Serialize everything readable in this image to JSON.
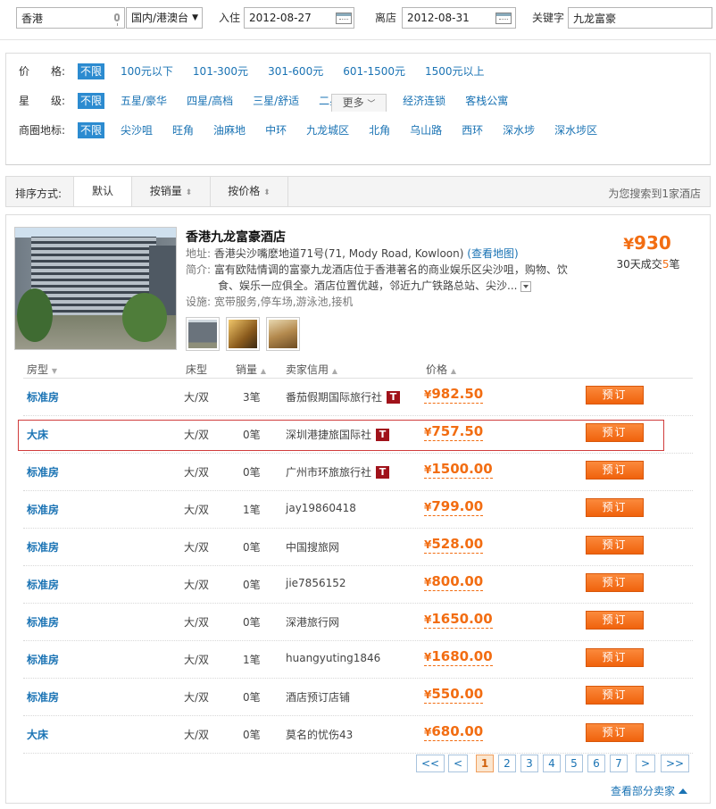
{
  "search": {
    "city": "香港",
    "region": "国内/港澳台",
    "checkin_label": "入住",
    "checkin": "2012-08-27",
    "checkout_label": "离店",
    "checkout": "2012-08-31",
    "keyword_label": "关键字",
    "keyword": "九龙富豪"
  },
  "filters": [
    {
      "label": "价　　格:",
      "options": [
        "不限",
        "100元以下",
        "101-300元",
        "301-600元",
        "601-1500元",
        "1500元以上"
      ]
    },
    {
      "label": "星　　级:",
      "options": [
        "不限",
        "五星/豪华",
        "四星/高档",
        "三星/舒适",
        "二星级及以下",
        "经济连锁",
        "客栈公寓"
      ]
    },
    {
      "label": "商圈地标:",
      "options": [
        "不限",
        "尖沙咀",
        "旺角",
        "油麻地",
        "中环",
        "九龙城区",
        "北角",
        "乌山路",
        "西环",
        "深水埗",
        "深水埗区"
      ]
    }
  ],
  "more_label": "更多",
  "sort": {
    "label": "排序方式:",
    "items": [
      "默认",
      "按销量",
      "按价格"
    ],
    "found": "为您搜索到1家酒店"
  },
  "hotel": {
    "name": "香港九龙富豪酒店",
    "address_label": "地址:",
    "address": "香港尖沙嘴麽地道71号(71, Mody Road, Kowloon)",
    "map_link": "(查看地图)",
    "intro_label": "简介:",
    "intro_line1": "富有欧陆情调的富豪九龙酒店位于香港著名的商业娱乐区尖沙咀，购物、饮",
    "intro_line2": "食、娱乐一应俱全。酒店位置优越，邻近九广铁路总站、尖沙...",
    "facilities_label": "设施:",
    "facilities": "宽带服务,停车场,游泳池,接机",
    "min_price_symbol": "¥",
    "min_price": "930",
    "deal_prefix": "30天成交",
    "deal_count": "5",
    "deal_suffix": "笔"
  },
  "table": {
    "headers": {
      "room": "房型",
      "bed": "床型",
      "sales": "销量",
      "seller": "卖家信用",
      "price": "价格"
    },
    "book_label": "预订",
    "rows": [
      {
        "room": "标准房",
        "bed": "大/双",
        "sales": "3笔",
        "seller": "番茄假期国际旅行社",
        "badge": "T",
        "price": "982.50"
      },
      {
        "room": "大床",
        "bed": "大/双",
        "sales": "0笔",
        "seller": "深圳港捷旅国际社",
        "badge": "T",
        "price": "757.50"
      },
      {
        "room": "标准房",
        "bed": "大/双",
        "sales": "0笔",
        "seller": "广州市环旅旅行社",
        "badge": "T",
        "price": "1500.00"
      },
      {
        "room": "标准房",
        "bed": "大/双",
        "sales": "1笔",
        "seller": "jay19860418",
        "badge": "",
        "price": "799.00"
      },
      {
        "room": "标准房",
        "bed": "大/双",
        "sales": "0笔",
        "seller": "中国搜旅网",
        "badge": "",
        "price": "528.00"
      },
      {
        "room": "标准房",
        "bed": "大/双",
        "sales": "0笔",
        "seller": "jie7856152",
        "badge": "",
        "price": "800.00"
      },
      {
        "room": "标准房",
        "bed": "大/双",
        "sales": "0笔",
        "seller": "深港旅行网",
        "badge": "",
        "price": "1650.00"
      },
      {
        "room": "标准房",
        "bed": "大/双",
        "sales": "1笔",
        "seller": "huangyuting1846",
        "badge": "",
        "price": "1680.00"
      },
      {
        "room": "标准房",
        "bed": "大/双",
        "sales": "0笔",
        "seller": "酒店预订店铺",
        "badge": "",
        "price": "550.00"
      },
      {
        "room": "大床",
        "bed": "大/双",
        "sales": "0笔",
        "seller": "莫名的忧伤43",
        "badge": "",
        "price": "680.00"
      }
    ]
  },
  "pagination": {
    "first": "<<",
    "prev": "<",
    "pages": [
      "1",
      "2",
      "3",
      "4",
      "5",
      "6",
      "7"
    ],
    "current": "1",
    "next": ">",
    "last": ">>"
  },
  "partial_sellers": "查看部分卖家",
  "colors": {
    "accent": "#f26d12",
    "link": "#1a73b4",
    "highlight": "#d03c3c"
  }
}
